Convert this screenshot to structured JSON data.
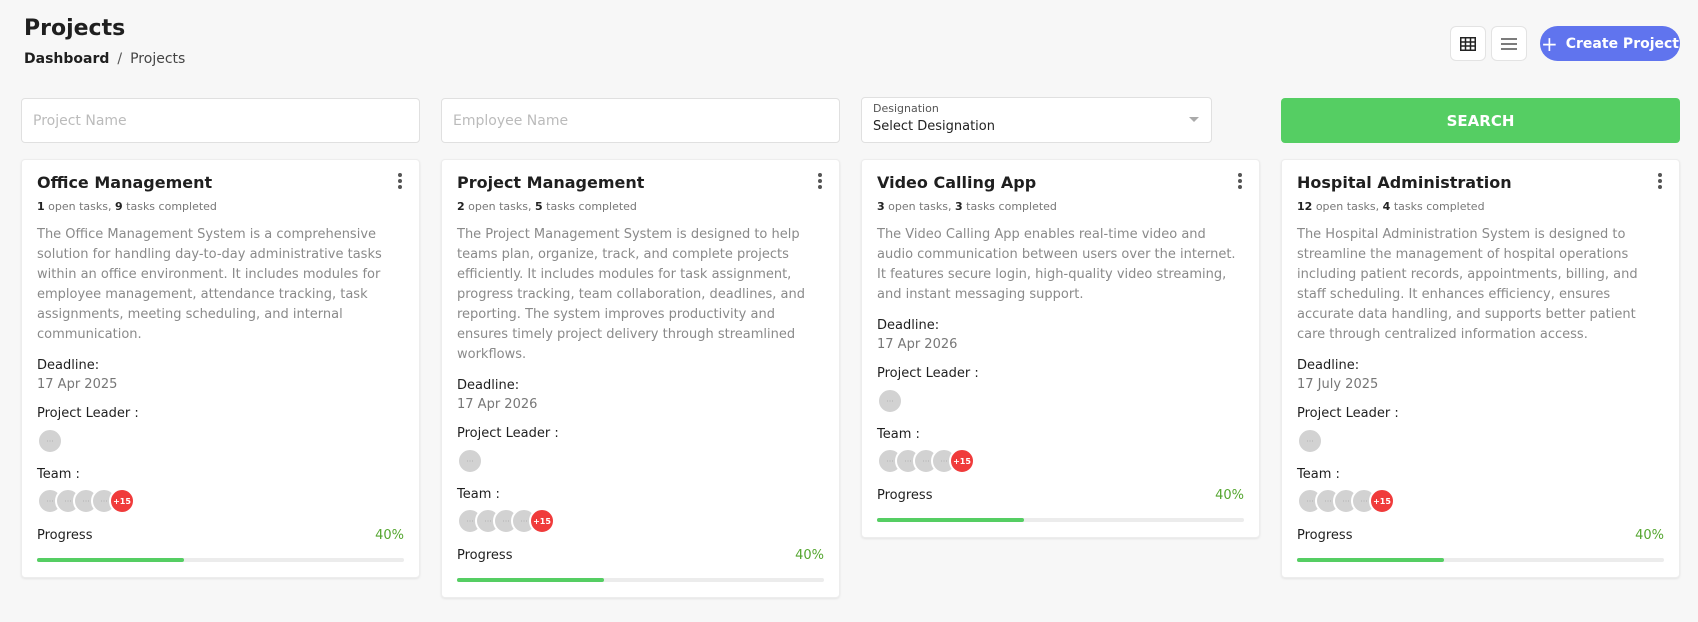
{
  "header": {
    "title": "Projects",
    "breadcrumb": {
      "home": "Dashboard",
      "separator": "/",
      "current": "Projects"
    },
    "grid_view_icon": "grid-view-icon",
    "list_view_icon": "list-view-icon",
    "create_label": "Create Project",
    "create_icon": "plus-icon",
    "accent_color": "#6074ee"
  },
  "filters": {
    "project_name_placeholder": "Project Name",
    "employee_name_placeholder": "Employee Name",
    "designation_label": "Designation",
    "designation_value": "Select Designation",
    "search_label": "SEARCH",
    "search_color": "#55ce63"
  },
  "projects": [
    {
      "title": "Office Management",
      "open_tasks": "1",
      "open_tasks_text": "open tasks,",
      "completed_tasks": "9",
      "completed_tasks_text": "tasks completed",
      "description": "The Office Management System is a comprehensive solution for handling day-to-day administrative tasks within an office environment. It includes modules for employee management, attendance tracking, task assignments, meeting scheduling, and internal communication.",
      "deadline_label": "Deadline:",
      "deadline": "17 Apr 2025",
      "leader_label": "Project Leader :",
      "team_label": "Team :",
      "team_more": "+15",
      "progress_label": "Progress",
      "progress_text": "40%",
      "progress": 0.4
    },
    {
      "title": "Project Management",
      "open_tasks": "2",
      "open_tasks_text": "open tasks,",
      "completed_tasks": "5",
      "completed_tasks_text": "tasks completed",
      "description": "The Project Management System is designed to help teams plan, organize, track, and complete projects efficiently. It includes modules for task assignment, progress tracking, team collaboration, deadlines, and reporting. The system improves productivity and ensures timely project delivery through streamlined workflows.",
      "deadline_label": "Deadline:",
      "deadline": "17 Apr 2026",
      "leader_label": "Project Leader :",
      "team_label": "Team :",
      "team_more": "+15",
      "progress_label": "Progress",
      "progress_text": "40%",
      "progress": 0.4
    },
    {
      "title": "Video Calling App",
      "open_tasks": "3",
      "open_tasks_text": "open tasks,",
      "completed_tasks": "3",
      "completed_tasks_text": "tasks completed",
      "description": "The Video Calling App enables real-time video and audio communication between users over the internet. It features secure login, high-quality video streaming, and instant messaging support.",
      "deadline_label": "Deadline:",
      "deadline": "17 Apr 2026",
      "leader_label": "Project Leader :",
      "team_label": "Team :",
      "team_more": "+15",
      "progress_label": "Progress",
      "progress_text": "40%",
      "progress": 0.4
    },
    {
      "title": "Hospital Administration",
      "open_tasks": "12",
      "open_tasks_text": "open tasks,",
      "completed_tasks": "4",
      "completed_tasks_text": "tasks completed",
      "description": "The Hospital Administration System is designed to streamline the management of hospital operations including patient records, appointments, billing, and staff scheduling. It enhances efficiency, ensures accurate data handling, and supports better patient care through centralized information access.",
      "deadline_label": "Deadline:",
      "deadline": "17 July 2025",
      "leader_label": "Project Leader :",
      "team_label": "Team :",
      "team_more": "+15",
      "progress_label": "Progress",
      "progress_text": "40%",
      "progress": 0.4
    }
  ]
}
